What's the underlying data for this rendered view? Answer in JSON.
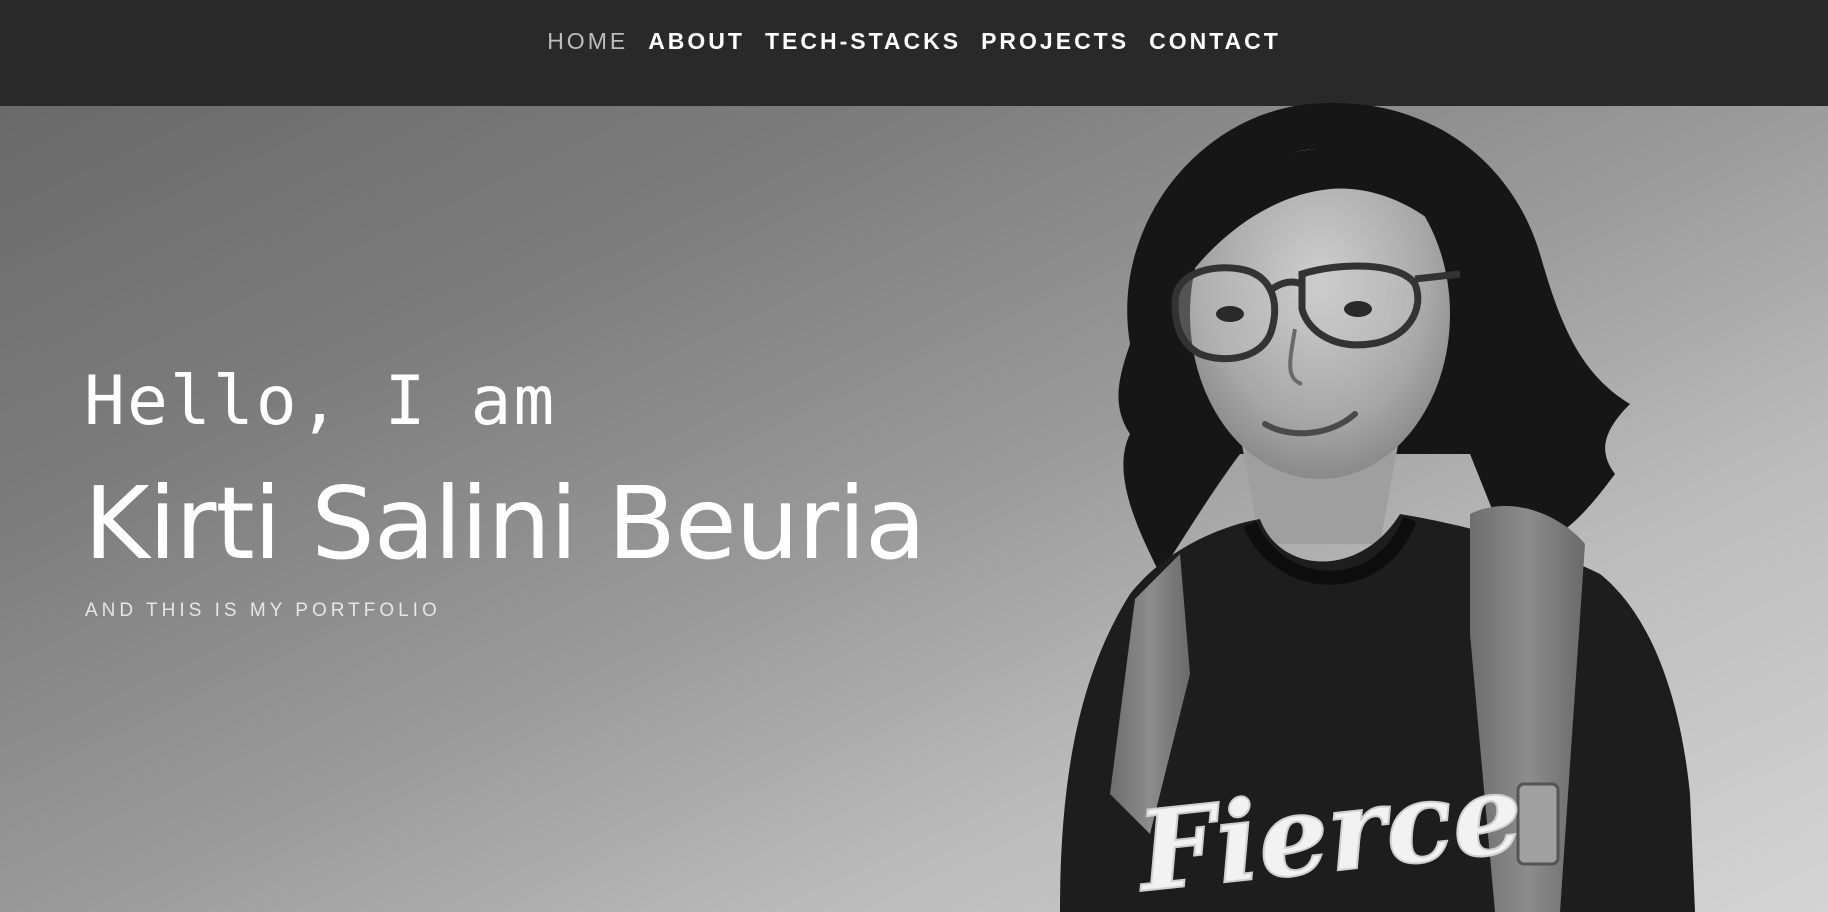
{
  "nav": {
    "items": [
      {
        "label": "HOME"
      },
      {
        "label": "ABOUT"
      },
      {
        "label": "TECH-STACKS"
      },
      {
        "label": "PROJECTS"
      },
      {
        "label": "CONTACT"
      }
    ],
    "active": "HOME"
  },
  "hero": {
    "greeting": "Hello, I am",
    "name": "Kirti Salini Beuria",
    "tagline": "AND THIS IS MY PORTFOLIO"
  },
  "portrait": {
    "shirt_text": "Fierce"
  },
  "colors": {
    "navbar_bg": "#292929",
    "nav_text": "#ffffff",
    "nav_active": "#bdbdbd",
    "hero_text": "#ffffff"
  }
}
